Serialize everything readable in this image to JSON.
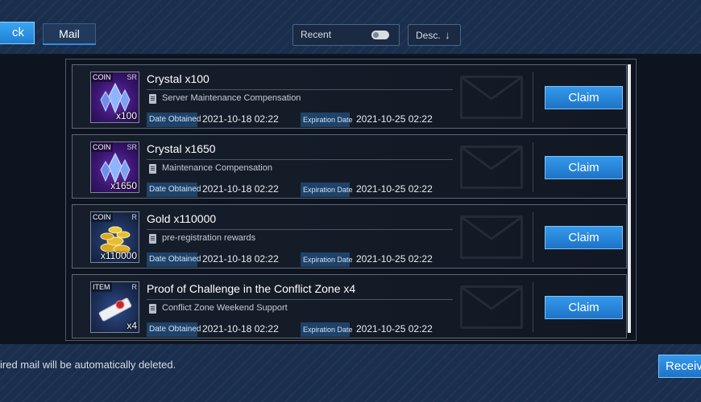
{
  "header": {
    "back_label": "ck",
    "tab_label": "Mail",
    "sort_label": "Recent",
    "order_label": "Desc."
  },
  "mails": [
    {
      "item_category": "COIN",
      "item_rarity": "SR",
      "item_qty": "x100",
      "title": "Crystal  x100",
      "subject": "Server Maintenance Compensation",
      "obtained_label": "Date Obtained",
      "obtained_date": "2021-10-18  02:22",
      "expire_label": "Expiration Date",
      "expire_date": "2021-10-25  02:22",
      "claim_label": "Claim"
    },
    {
      "item_category": "COIN",
      "item_rarity": "SR",
      "item_qty": "x1650",
      "title": "Crystal  x1650",
      "subject": "Maintenance Compensation",
      "obtained_label": "Date Obtained",
      "obtained_date": "2021-10-18  02:22",
      "expire_label": "Expiration Date",
      "expire_date": "2021-10-25  02:22",
      "claim_label": "Claim"
    },
    {
      "item_category": "COIN",
      "item_rarity": "R",
      "item_qty": "x110000",
      "title": "Gold  x110000",
      "subject": "pre-registration rewards",
      "obtained_label": "Date Obtained",
      "obtained_date": "2021-10-18  02:22",
      "expire_label": "Expiration Date",
      "expire_date": "2021-10-25  02:22",
      "claim_label": "Claim"
    },
    {
      "item_category": "ITEM",
      "item_rarity": "R",
      "item_qty": "x4",
      "title": "Proof of Challenge in the Conflict Zone  x4",
      "subject": "Conflict Zone Weekend Support",
      "obtained_label": "Date Obtained",
      "obtained_date": "2021-10-18  02:22",
      "expire_label": "Expiration Date",
      "expire_date": "2021-10-25  02:22",
      "claim_label": "Claim"
    }
  ],
  "footer": {
    "note": "ired mail will be automatically deleted.",
    "receive_all_label": "Receiv"
  },
  "colors": {
    "accent": "#2a8be6",
    "background": "#0d1420",
    "header_bg": "#1a2e4d"
  }
}
